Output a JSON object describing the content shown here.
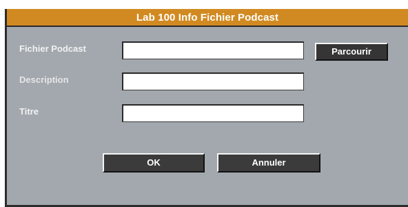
{
  "window": {
    "title": "Lab 100 Info Fichier Podcast"
  },
  "form": {
    "podcast_file": {
      "label": "Fichier Podcast",
      "value": "",
      "placeholder": ""
    },
    "description": {
      "label": "Description",
      "value": "",
      "placeholder": ""
    },
    "title": {
      "label": "Titre",
      "value": "",
      "placeholder": ""
    }
  },
  "buttons": {
    "browse_label": "Parcourir",
    "ok_label": "OK",
    "cancel_label": "Annuler"
  },
  "colors": {
    "titlebar": "#d18a21",
    "panel": "#a2a8ae",
    "button": "#3b3b3b"
  }
}
